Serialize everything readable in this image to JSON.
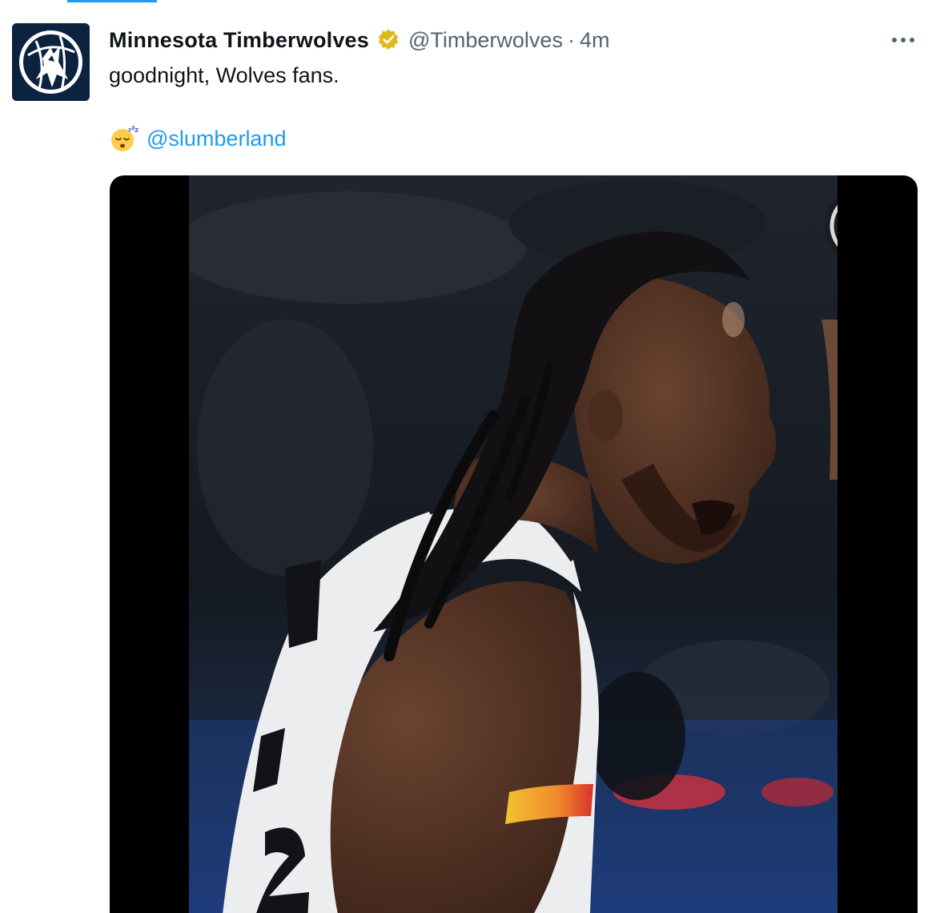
{
  "tweet": {
    "author": {
      "display_name": "Minnesota Timberwolves",
      "handle": "@Timberwolves",
      "verified": true,
      "avatar_icon": "timberwolves-logo-icon"
    },
    "separator": "·",
    "timestamp": "4m",
    "text": "goodnight, Wolves fans.",
    "mention_emoji": "sleepy-face-emoji",
    "mention": "@slumberland",
    "media": {
      "type": "video",
      "overlay_logo": "timberwolves-logo-icon"
    }
  },
  "colors": {
    "link": "#1d9bf0",
    "text_primary": "#0f1419",
    "text_secondary": "#536471",
    "verified_gold": "#e2b719",
    "brand_navy": "#0c2340"
  }
}
